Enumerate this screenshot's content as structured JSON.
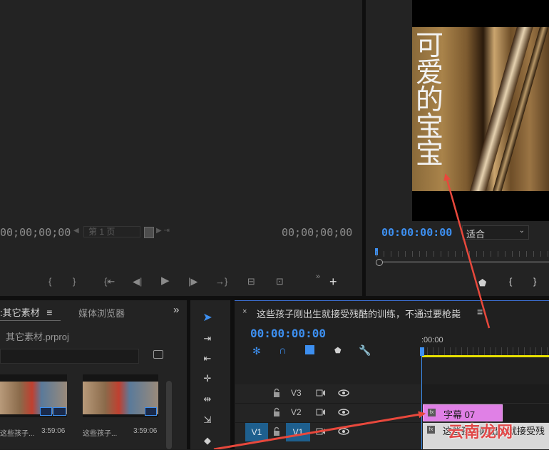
{
  "source_monitor": {
    "timecode_in": "00;00;00;00",
    "page_label": "第 1 页",
    "timecode_out": "00;00;00;00"
  },
  "program_monitor": {
    "timecode": "00:00:00:00",
    "fit_label": "适合",
    "caption_text": "可爱的宝宝"
  },
  "project_panel": {
    "tab_active": "项目:其它素材",
    "tab_active_visible": ":其它素材",
    "tab_media_browser": "媒体浏览器",
    "project_file": "其它素材.prproj",
    "clips": [
      {
        "name": "这些孩子...",
        "duration": "3:59:06"
      },
      {
        "name": "这些孩子...",
        "duration": "3:59:06"
      }
    ]
  },
  "timeline": {
    "sequence_title": "这些孩子刚出生就接受残酷的训练，不通过要枪毙",
    "timecode": "00:00:00:00",
    "ruler_start": ":00:00",
    "tracks": [
      "V3",
      "V2",
      "V1"
    ],
    "source_patch": "V1",
    "clip_caption": "字幕 07",
    "clip_video": "这些孩子刚出生就接受残",
    "clip_video_tail": "接受残"
  },
  "watermark": "云南龙网",
  "colors": {
    "accent_blue": "#3d8ff0",
    "caption_clip": "#e080e6",
    "arrow_red": "#e8483c",
    "work_area_yellow": "#e8e000"
  },
  "icons": [
    "play-icon",
    "step-back-icon",
    "step-forward-icon",
    "go-to-in-icon",
    "go-to-out-icon",
    "mark-in-icon",
    "mark-out-icon",
    "insert-icon",
    "overwrite-icon",
    "add-button-icon",
    "selection-tool-icon",
    "track-select-icon",
    "ripple-edit-icon",
    "rolling-edit-icon",
    "rate-stretch-icon",
    "razor-icon",
    "slip-icon",
    "snap-icon",
    "linked-selection-icon",
    "add-marker-icon",
    "wrench-icon",
    "lock-icon",
    "eye-icon",
    "search-icon"
  ]
}
